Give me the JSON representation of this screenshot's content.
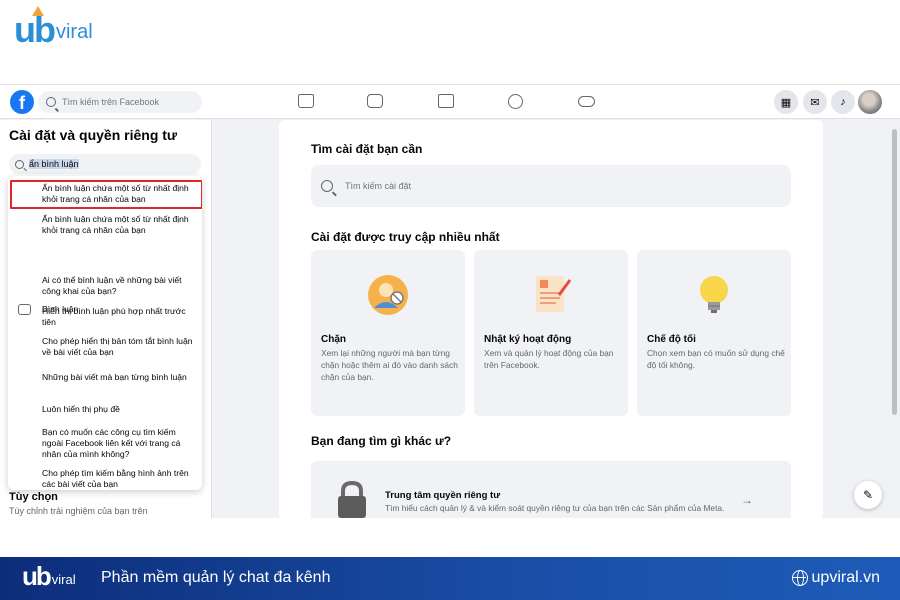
{
  "brand": {
    "logo_main": "ub",
    "logo_suffix": "viral",
    "tagline": "Phần mềm quản lý chat đa kênh",
    "website": "upviral.vn",
    "colors": {
      "primary": "#1d5fae",
      "accent": "#f1a33a",
      "footer": "#1a4fa8"
    }
  },
  "fb": {
    "logo_letter": "f",
    "search_placeholder": "Tìm kiếm trên Facebook",
    "nav_icons": [
      "home-icon",
      "video-icon",
      "marketplace-icon",
      "groups-icon",
      "gaming-icon"
    ],
    "right_icons": [
      "menu-grid-icon",
      "messenger-icon",
      "bell-icon",
      "avatar"
    ],
    "accent": "#1877f2"
  },
  "left": {
    "title": "Cài đặt và quyền riêng tư",
    "search_value": "ẩn bình luận",
    "results": [
      "Ẩn bình luận chứa một số từ nhất định khỏi trang cá nhân của bạn",
      "Ẩn bình luận chứa một số từ nhất định khỏi trang cá nhân của bạn",
      "Bình luận",
      "Ai có thể bình luận về những bài viết công khai của bạn?",
      "Hiển thị bình luận phù hợp nhất trước tiên",
      "Cho phép hiển thị bản tóm tắt bình luận về bài viết của bạn",
      "Những bài viết mà bạn từng bình luận",
      "Luôn hiển thị phụ đề",
      "Bạn có muốn các công cụ tìm kiếm ngoài Facebook liên kết với trang cá nhân của mình không?",
      "Cho phép tìm kiếm bằng hình ảnh trên các bài viết của bạn"
    ],
    "section_title": "Tùy chọn",
    "section_sub": "Tùy chỉnh trải nghiệm của bạn trên"
  },
  "main": {
    "find_heading": "Tìm cài đặt bạn cần",
    "search_placeholder": "Tìm kiếm cài đặt",
    "most_heading": "Cài đặt được truy cập nhiều nhất",
    "tiles": [
      {
        "title": "Chặn",
        "desc": "Xem lại những người mà bạn từng chặn hoặc thêm ai đó vào danh sách chặn của bạn."
      },
      {
        "title": "Nhật ký hoạt động",
        "desc": "Xem và quản lý hoạt động của bạn trên Facebook."
      },
      {
        "title": "Chế độ tối",
        "desc": "Chọn xem bạn có muốn sử dụng chế độ tối không."
      }
    ],
    "other_heading": "Bạn đang tìm gì khác ư?",
    "privacy": {
      "title": "Trung tâm quyền riêng tư",
      "desc": "Tìm hiểu cách quản lý & và kiểm soát quyền riêng tư của bạn trên các Sản phẩm của Meta.",
      "arrow": "→"
    }
  }
}
